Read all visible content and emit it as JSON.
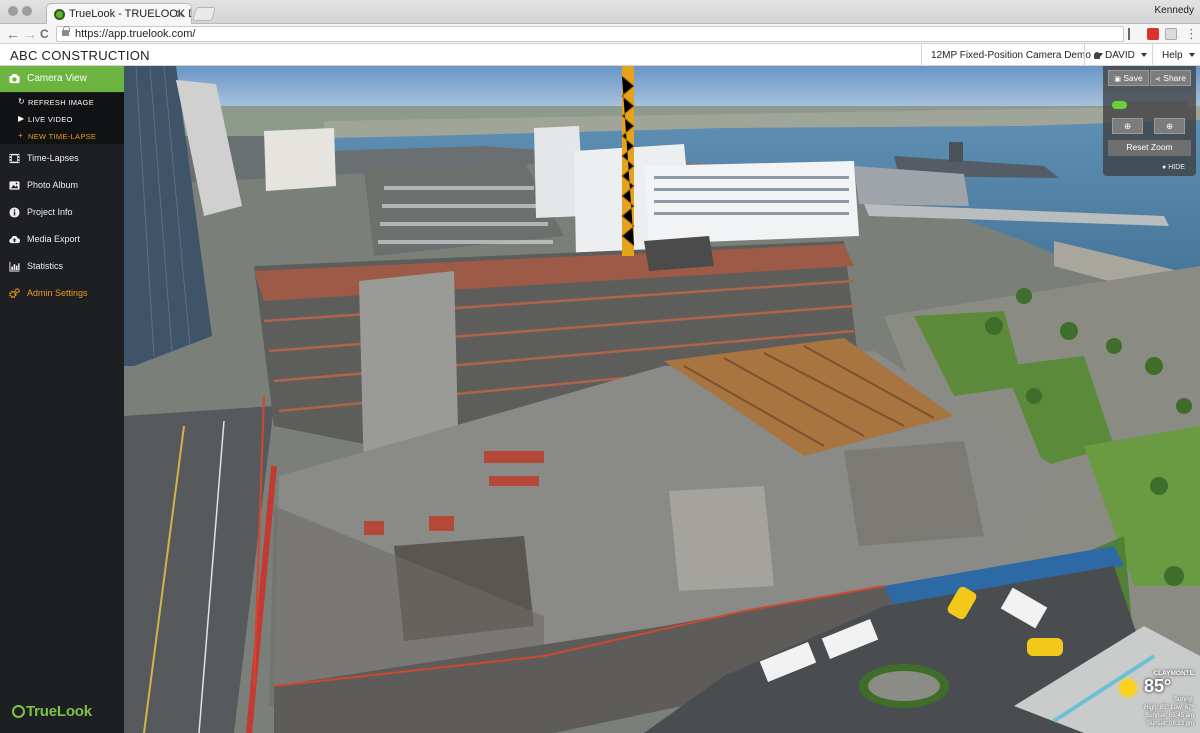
{
  "browser": {
    "tab_title": "TrueLook - TRUELOOK DEMO",
    "tab_close": "✕",
    "profile_name": "Kennedy",
    "url": "https://app.truelook.com/",
    "back_icon": "←",
    "forward_icon": "→",
    "reload_icon": "C",
    "menu_icon": "⋮"
  },
  "header": {
    "company": "ABC CONSTRUCTION",
    "camera_select": "12MP Fixed-Position Camera Demo",
    "user": "DAVID",
    "help": "Help"
  },
  "sidebar": {
    "active_item": "Camera View",
    "sub_items": [
      {
        "label": "REFRESH IMAGE",
        "icon": "↻"
      },
      {
        "label": "LIVE VIDEO",
        "icon": "▶"
      },
      {
        "label": "NEW TIME-LAPSE",
        "icon": "+"
      }
    ],
    "items": [
      {
        "label": "Time-Lapses",
        "icon": "film-icon"
      },
      {
        "label": "Photo Album",
        "icon": "image-icon"
      },
      {
        "label": "Project Info",
        "icon": "info-icon"
      },
      {
        "label": "Media Export",
        "icon": "cloud-upload-icon"
      },
      {
        "label": "Statistics",
        "icon": "bar-chart-icon"
      },
      {
        "label": "Admin Settings",
        "icon": "gear-icon"
      }
    ],
    "logo": "TrueLook"
  },
  "viewer": {
    "save": "Save",
    "share": "Share",
    "zoom_in": "⊕",
    "zoom_out": "⊕",
    "reset_zoom": "Reset Zoom",
    "hide": "HIDE",
    "zoom_level": 0.2
  },
  "weather": {
    "location": "CLAYMONTE",
    "temperature": "85°",
    "condition": "Sunny",
    "high_low": "High: 85° Low: 67°",
    "sunrise": "Sunrise: 05:45 am",
    "sunset": "Sunset: 08:13 pm"
  },
  "colors": {
    "accent_green": "#6cb33f",
    "sidebar_bg": "#1d1f22",
    "admin_orange": "#f29a1f"
  }
}
